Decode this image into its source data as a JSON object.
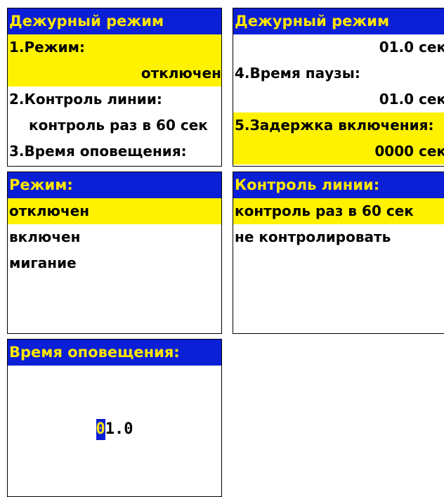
{
  "p1": {
    "title": "Дежурный режим",
    "rows": [
      "1.Режим:",
      "отключен",
      "2.Контроль линии:",
      "контроль раз в 60 сек",
      "3.Время оповещения:"
    ]
  },
  "p2": {
    "title": "Дежурный режим",
    "rows": [
      "01.0 сек",
      "4.Время паузы:",
      "01.0 сек",
      "5.Задержка включения:",
      "0000 сек"
    ]
  },
  "p3": {
    "title": "Режим:",
    "options": [
      "отключен",
      "включен",
      "мигание"
    ]
  },
  "p4": {
    "title": "Контроль линии:",
    "options": [
      "контроль раз в 60 сек",
      "не контролировать"
    ]
  },
  "p5": {
    "title": "Время оповещения:",
    "cursor_digit": "0",
    "rest": "1.0"
  },
  "colors": {
    "header_bg": "#0a1fd6",
    "header_text": "#ffe600",
    "selection": "#fff200"
  }
}
